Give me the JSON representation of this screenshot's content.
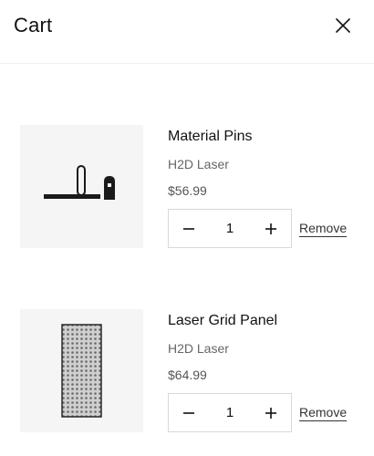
{
  "header": {
    "title": "Cart",
    "close_icon": "close-icon"
  },
  "items": [
    {
      "name": "Material Pins",
      "variant": "H2D Laser",
      "price": "$56.99",
      "quantity": "1",
      "remove_label": "Remove",
      "image": "material-pins-image"
    },
    {
      "name": "Laser Grid Panel",
      "variant": "H2D Laser",
      "price": "$64.99",
      "quantity": "1",
      "remove_label": "Remove",
      "image": "laser-grid-panel-image"
    }
  ],
  "colors": {
    "text": "#111111",
    "muted": "#666666",
    "thumb_bg": "#f5f5f5",
    "border": "#d9d9d9"
  }
}
